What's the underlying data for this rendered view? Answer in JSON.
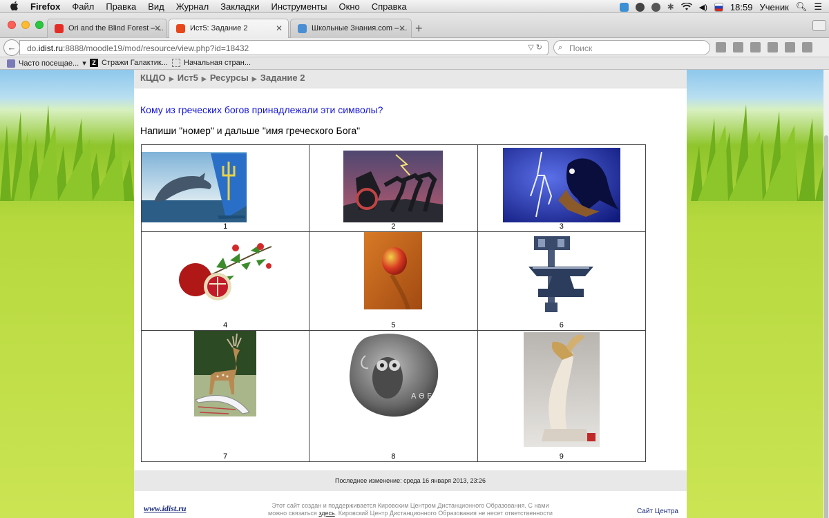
{
  "menubar": {
    "app": "Firefox",
    "items": [
      "Файл",
      "Правка",
      "Вид",
      "Журнал",
      "Закладки",
      "Инструменты",
      "Окно",
      "Справка"
    ],
    "clock": "18:59",
    "user": "Ученик"
  },
  "tabs": [
    {
      "label": "Ori and the Blind Forest – ...",
      "icon": "youtube-icon",
      "color": "#e52d27"
    },
    {
      "label": "Ист5: Задание 2",
      "icon": "moodle-icon",
      "color": "#e8471c"
    },
    {
      "label": "Школьные Знания.com – ...",
      "icon": "znanija-icon",
      "color": "#4a8fd4"
    }
  ],
  "nav": {
    "url_host": "do.idist.ru",
    "url_prefix": "do.",
    "url_domain": "idist.ru",
    "url_rest": ":8888/moodle19/mod/resource/view.php?id=18432",
    "search_placeholder": "Поиск"
  },
  "bookmarks": [
    {
      "label": "Часто посещае...",
      "icon": "folder-icon"
    },
    {
      "label": "Стражи Галактик...",
      "icon": "z-icon"
    },
    {
      "label": "Начальная стран...",
      "icon": "page-icon"
    }
  ],
  "breadcrumb": [
    "КЦДО",
    "Ист5",
    "Ресурсы",
    "Задание 2"
  ],
  "content": {
    "question": "Кому из греческих богов принадлежали эти символы?",
    "instruction": "Напиши \"номер\" и дальше \"имя греческого Бога\""
  },
  "grid": [
    {
      "number": "1",
      "image": "dolphin-trident"
    },
    {
      "number": "2",
      "image": "chariot-horses"
    },
    {
      "number": "3",
      "image": "lightning-eagle"
    },
    {
      "number": "4",
      "image": "pomegranate"
    },
    {
      "number": "5",
      "image": "apple"
    },
    {
      "number": "6",
      "image": "hammer-anvil"
    },
    {
      "number": "7",
      "image": "deer"
    },
    {
      "number": "8",
      "image": "owl-coin"
    },
    {
      "number": "9",
      "image": "winged-sandal-sculpture"
    }
  ],
  "footer": {
    "last_modified": "Последнее изменение: среда 16 января 2013, 23:26",
    "logo": "www.idist.ru",
    "note_part1": "Этот сайт создан и поддерживается Кировским Центром Дистанционного Образования. С нами",
    "note_part2": "можно связаться",
    "note_link": "здесь",
    "note_part3": ". Кировский Центр Дистанционного Образования не несет ответственности за",
    "site_link": "Сайт Центра"
  },
  "colors": {
    "question": "#1414d8",
    "link": "#1a2a7a",
    "grass": "#8fc52c"
  }
}
